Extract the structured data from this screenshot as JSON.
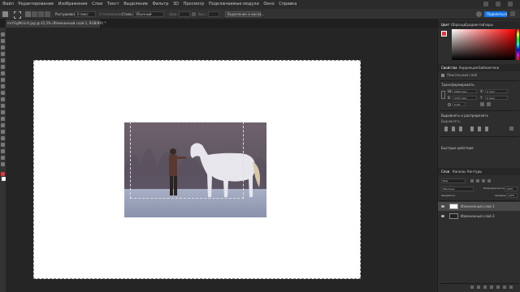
{
  "menu": {
    "items": [
      "Файл",
      "Редактирование",
      "Изображение",
      "Слои",
      "Текст",
      "Выделение",
      "Фильтр",
      "3D",
      "Просмотр",
      "Подключаемые модули",
      "Окно",
      "Справка"
    ]
  },
  "options_bar": {
    "feather_label": "Растушевка:",
    "feather_value": "0 пикс",
    "smoothing_label": "Сглаживание",
    "style_label": "Стиль:",
    "style_value": "Обычный",
    "width_label": "Шир.:",
    "height_label": "Выс.:",
    "select_mask_button": "Выделение и маска...",
    "share_button": "Поделиться"
  },
  "document_tab": {
    "title": "mrYGgMcUcX.jpg @ 45,5% (Измененный слой 1, RGB/8#) *"
  },
  "color_panel": {
    "tabs": [
      "Цвет",
      "Образцы",
      "Градиенты",
      "Узоры"
    ],
    "fg_color": "#d93a3a",
    "bg_color": "#ffffff"
  },
  "properties_panel": {
    "tabs": [
      "Свойства",
      "Коррекция",
      "Библиотеки"
    ],
    "layer_kind": "Пиксельный слой",
    "transform_title": "Трансформировать",
    "w_label": "Ш:",
    "w_value": "2060 пикс",
    "x_label": "X:",
    "x_value": "0 пикс",
    "h_label": "В:",
    "h_value": "1707 пикс",
    "y_label": "Y:",
    "y_value": "0 пикс",
    "angle_value": "0,00°",
    "align_title": "Выровнять и распределить",
    "align_sub": "Выровнять:",
    "quick_actions_title": "Быстрые действия"
  },
  "layers_panel": {
    "tabs": [
      "Слои",
      "Каналы",
      "Контуры"
    ],
    "kind_filter": "Вид",
    "blend_mode": "Обычные",
    "opacity_label": "Непрозрачность:",
    "opacity_value": "100%",
    "lock_label": "Закрепить:",
    "fill_label": "Заливка:",
    "fill_value": "100%",
    "layers": [
      {
        "name": "Измененный слой 1"
      },
      {
        "name": "Измененный слой 2"
      }
    ]
  }
}
